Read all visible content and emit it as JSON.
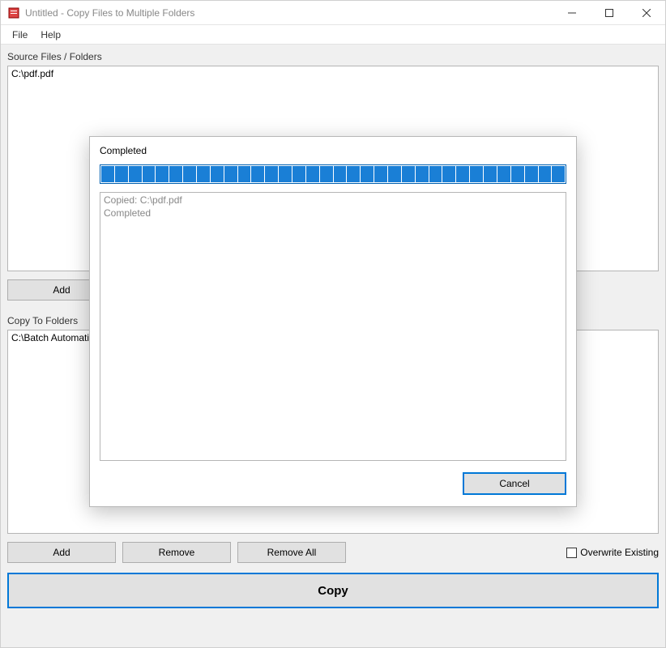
{
  "titlebar": {
    "title": "Untitled - Copy Files to Multiple Folders"
  },
  "menubar": {
    "file": "File",
    "help": "Help"
  },
  "source": {
    "label": "Source Files / Folders",
    "items": [
      "C:\\pdf.pdf"
    ],
    "add": "Add"
  },
  "dest": {
    "label": "Copy To Folders",
    "items": [
      "C:\\Batch Automation"
    ],
    "add": "Add",
    "remove": "Remove",
    "remove_all": "Remove All"
  },
  "overwrite_label": "Overwrite Existing",
  "copy_label": "Copy",
  "dialog": {
    "title": "Completed",
    "log": [
      "Copied: C:\\pdf.pdf",
      "Completed"
    ],
    "cancel": "Cancel"
  }
}
